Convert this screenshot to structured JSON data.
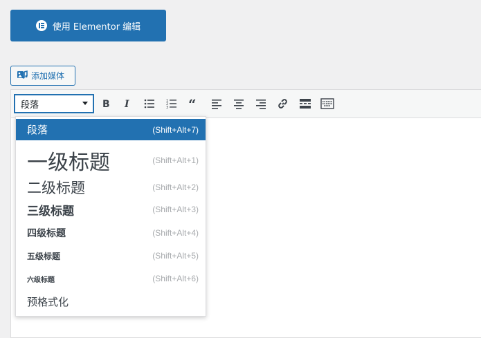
{
  "elementor_button": {
    "label": "使用 Elementor 编辑"
  },
  "add_media": {
    "label": "添加媒体"
  },
  "toolbar": {
    "format_select": {
      "value": "段落"
    },
    "buttons": [
      "bold-icon",
      "italic-icon",
      "bullet-list-icon",
      "numbered-list-icon",
      "blockquote-icon",
      "align-left-icon",
      "align-center-icon",
      "align-right-icon",
      "link-icon",
      "read-more-icon",
      "toolbar-toggle-icon"
    ]
  },
  "format_menu": {
    "items": [
      {
        "label": "段落",
        "shortcut": "(Shift+Alt+7)"
      },
      {
        "label": "一级标题",
        "shortcut": "(Shift+Alt+1)"
      },
      {
        "label": "二级标题",
        "shortcut": "(Shift+Alt+2)"
      },
      {
        "label": "三级标题",
        "shortcut": "(Shift+Alt+3)"
      },
      {
        "label": "四级标题",
        "shortcut": "(Shift+Alt+4)"
      },
      {
        "label": "五级标题",
        "shortcut": "(Shift+Alt+5)"
      },
      {
        "label": "六级标题",
        "shortcut": "(Shift+Alt+6)"
      },
      {
        "label": "预格式化",
        "shortcut": ""
      }
    ]
  },
  "colors": {
    "accent": "#2271b1",
    "page_bg": "#f0f0f1",
    "toolbar_bg": "#f6f7f7"
  }
}
